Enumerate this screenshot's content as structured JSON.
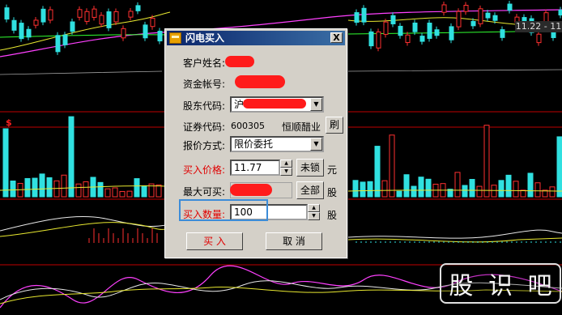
{
  "dialog": {
    "title": "闪电买入",
    "close_glyph": "X",
    "customer_name_label": "客户姓名:",
    "account_label": "资金帐号:",
    "shareholder_code_label": "股东代码:",
    "shareholder_code_value": "沪",
    "security_code_label": "证券代码:",
    "security_code_value": "600305",
    "security_name_value": "恒顺醋业",
    "refresh_button": "刷",
    "quote_method_label": "报价方式:",
    "quote_method_value": "限价委托",
    "buy_price_label": "买入价格:",
    "buy_price_value": "11.77",
    "unlock_button": "未锁",
    "price_unit": "元",
    "max_buy_label": "最大可买:",
    "all_button": "全部",
    "share_unit_1": "股",
    "buy_qty_label": "买入数量:",
    "buy_qty_value": "100",
    "share_unit_2": "股",
    "buy_button": "买 入",
    "cancel_button": "取 消"
  },
  "chart": {
    "price_tag": "11.22 - 11",
    "dollar_marker": "$"
  },
  "watermark": [
    "股",
    "识",
    "吧"
  ],
  "colors": {
    "up": "#ff3030",
    "down": "#30e0e0",
    "ma_yellow": "#e8e830",
    "ma_magenta": "#ff40ff",
    "ma_green": "#30ff30",
    "title_bar": "#0a246a",
    "label_red": "#e00000",
    "redaction": "#ff1b1b",
    "highlight": "#3c8cd8"
  }
}
